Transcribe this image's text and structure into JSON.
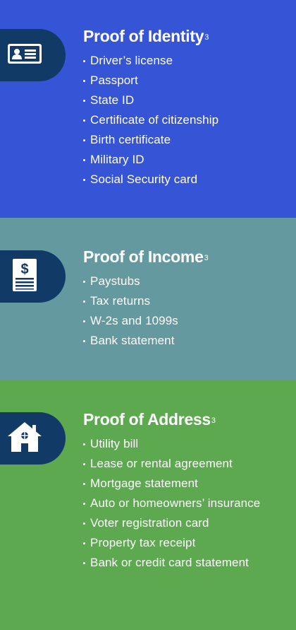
{
  "identity": {
    "title": "Proof of Identity",
    "footnote": "3",
    "icon": "id-card-icon",
    "items": [
      "Driver’s license",
      "Passport",
      "State ID",
      "Certificate of citizenship",
      "Birth certificate",
      "Military ID",
      "Social Security card"
    ]
  },
  "income": {
    "title": "Proof of Income",
    "footnote": "3",
    "icon": "pay-document-icon",
    "items": [
      "Paystubs",
      "Tax returns",
      "W-2s and 1099s",
      "Bank statement"
    ]
  },
  "address": {
    "title": "Proof of Address",
    "footnote": "3",
    "icon": "house-icon",
    "items": [
      "Utility bill",
      "Lease or rental agreement",
      "Mortgage statement",
      "Auto or homeowners’ insurance",
      "Voter registration card",
      "Property tax receipt",
      "Bank or credit card statement"
    ]
  },
  "colors": {
    "identity_bg": "#3654d6",
    "income_bg": "#6499a0",
    "address_bg": "#5ca94f",
    "tab_bg": "#123a66",
    "text": "#ffffff"
  }
}
